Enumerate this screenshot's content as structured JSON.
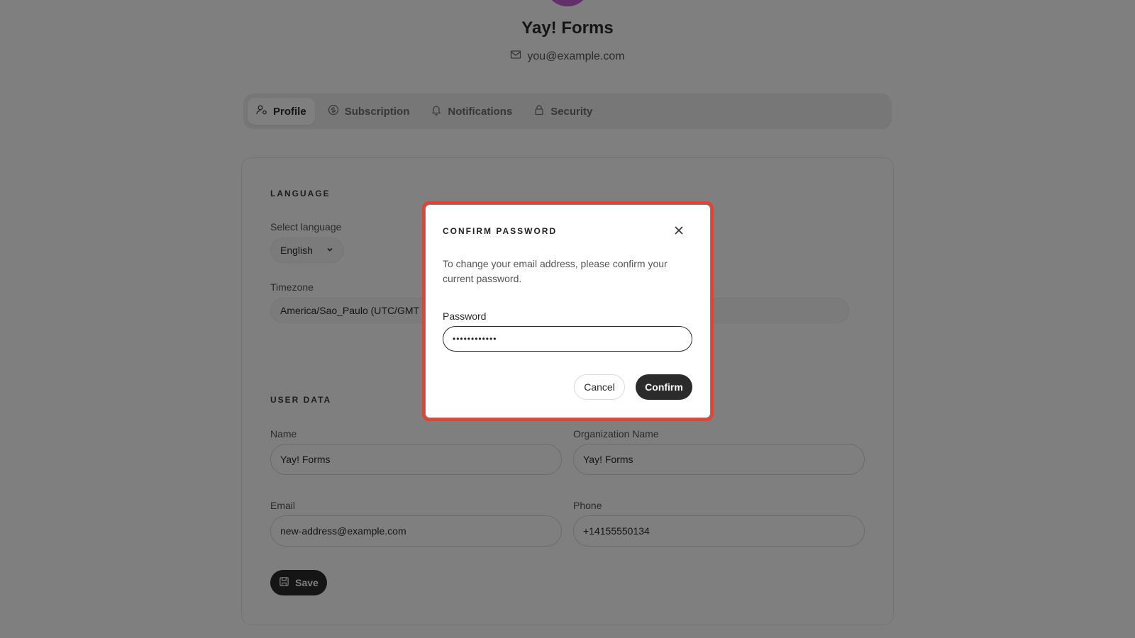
{
  "header": {
    "org_name": "Yay! Forms",
    "email": "you@example.com"
  },
  "tabs": [
    {
      "label": "Profile",
      "icon": "user-settings-icon",
      "active": true
    },
    {
      "label": "Subscription",
      "icon": "dollar-circle-icon",
      "active": false
    },
    {
      "label": "Notifications",
      "icon": "bell-icon",
      "active": false
    },
    {
      "label": "Security",
      "icon": "lock-icon",
      "active": false
    }
  ],
  "language_section": {
    "title": "LANGUAGE",
    "select_language_label": "Select language",
    "language_value": "English",
    "timezone_label": "Timezone",
    "timezone_value": "America/Sao_Paulo (UTC/GMT -"
  },
  "user_data": {
    "title": "USER DATA",
    "name_label": "Name",
    "name_value": "Yay! Forms",
    "org_label": "Organization Name",
    "org_value": "Yay! Forms",
    "email_label": "Email",
    "email_value": "new-address@example.com",
    "phone_label": "Phone",
    "phone_value": "+14155550134",
    "save_label": "Save"
  },
  "modal": {
    "title": "CONFIRM PASSWORD",
    "description": "To change your email address, please confirm your current password.",
    "password_label": "Password",
    "password_value": "••••••••••••",
    "cancel_label": "Cancel",
    "confirm_label": "Confirm"
  },
  "colors": {
    "accent": "#2b2b2b",
    "highlight": "#e8412f",
    "avatar": "#c65fd6"
  }
}
